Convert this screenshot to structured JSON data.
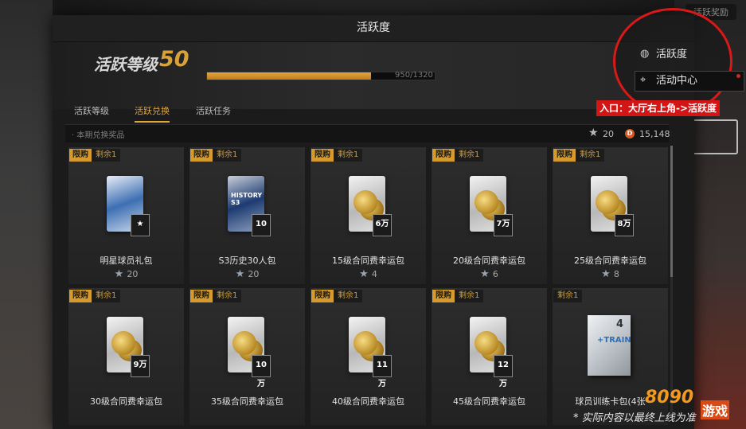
{
  "topright_chip": "活跃奖励",
  "panel": {
    "title": "活跃度",
    "level_label": "活跃等级",
    "level_value": "50",
    "xp_text": "950/1320",
    "xp_fraction": 0.72,
    "tabs": [
      {
        "label": "活跃等级",
        "active": false
      },
      {
        "label": "活跃兑换",
        "active": true
      },
      {
        "label": "活跃任务",
        "active": false
      }
    ],
    "section_label": "· 本期兑换奖品",
    "currency": {
      "stars": "20",
      "coins": "15,148",
      "coin_glyph": "D"
    }
  },
  "cards": [
    {
      "tag_buy": "限购",
      "tag_left": "剩余1",
      "name": "明星球员礼包",
      "price": "20",
      "art": "blue",
      "badge": "★"
    },
    {
      "tag_buy": "限购",
      "tag_left": "剩余1",
      "name": "S3历史30人包",
      "price": "20",
      "art": "navy",
      "badge": "10",
      "art_text": "HISTORY S3"
    },
    {
      "tag_buy": "限购",
      "tag_left": "剩余1",
      "name": "15级合同费幸运包",
      "price": "4",
      "art": "gold",
      "badge": "6万"
    },
    {
      "tag_buy": "限购",
      "tag_left": "剩余1",
      "name": "20级合同费幸运包",
      "price": "6",
      "art": "gold",
      "badge": "7万"
    },
    {
      "tag_buy": "限购",
      "tag_left": "剩余1",
      "name": "25级合同费幸运包",
      "price": "8",
      "art": "gold",
      "badge": "8万"
    },
    {
      "tag_buy": "限购",
      "tag_left": "剩余1",
      "name": "30级合同费幸运包",
      "price": "",
      "art": "gold",
      "badge": "9万"
    },
    {
      "tag_buy": "限购",
      "tag_left": "剩余1",
      "name": "35级合同费幸运包",
      "price": "",
      "art": "gold",
      "badge": "10万"
    },
    {
      "tag_buy": "限购",
      "tag_left": "剩余1",
      "name": "40级合同费幸运包",
      "price": "",
      "art": "gold",
      "badge": "11万"
    },
    {
      "tag_buy": "限购",
      "tag_left": "剩余1",
      "name": "45级合同费幸运包",
      "price": "",
      "art": "gold",
      "badge": "12万"
    },
    {
      "tag_buy": "",
      "tag_left": "剩余1",
      "name": "球员训练卡包(4张",
      "price": "",
      "art": "cube",
      "badge": "4",
      "art_text": "+TRAIN"
    }
  ],
  "overlay_menu": {
    "item1": "活跃度",
    "item2": "活动中心",
    "callout": "入口：大厅右上角->活跃度"
  },
  "watermark": "* 实际内容以最终上线为准",
  "logo": {
    "a": "8090",
    "b": "游戏"
  },
  "colors": {
    "accent": "#e0a63e",
    "highlight_red": "#d91818"
  }
}
